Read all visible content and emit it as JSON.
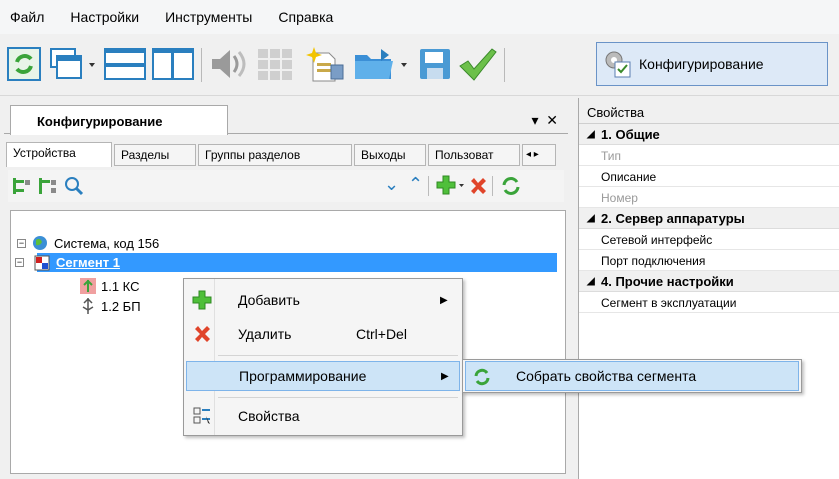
{
  "menu": {
    "items": [
      "Файл",
      "Настройки",
      "Инструменты",
      "Справка"
    ]
  },
  "toolbar": {
    "configure_label": "Конфигурирование"
  },
  "left_panel": {
    "title": "Конфигурирование",
    "tabs": [
      "Устройства",
      "Разделы",
      "Группы разделов",
      "Выходы",
      "Пользоват"
    ],
    "tree": {
      "system": "Система, код 156",
      "segment": "Сегмент 1",
      "child1": "1.1 КС",
      "child2": "1.2 БП"
    }
  },
  "properties": {
    "header": "Свойства",
    "groups": [
      {
        "title": "1. Общие",
        "rows": [
          {
            "label": "Тип",
            "disabled": true
          },
          {
            "label": "Описание",
            "disabled": false
          },
          {
            "label": "Номер",
            "disabled": true
          }
        ]
      },
      {
        "title": "2. Сервер аппаратуры",
        "rows": [
          {
            "label": "Сетевой интерфейс",
            "disabled": false
          },
          {
            "label": "Порт подключения",
            "disabled": false
          }
        ]
      },
      {
        "title": "4. Прочие настройки",
        "rows": [
          {
            "label": "Сегмент в эксплуатации",
            "disabled": false
          }
        ]
      }
    ]
  },
  "context_menu": {
    "add": "Добавить",
    "delete": "Удалить",
    "delete_shortcut": "Ctrl+Del",
    "programming": "Программирование",
    "properties": "Свойства"
  },
  "submenu": {
    "collect": "Собрать свойства сегмента"
  },
  "colors": {
    "accent": "#3399ff",
    "highlight": "#cde4f7",
    "selection": "#3399ff"
  }
}
